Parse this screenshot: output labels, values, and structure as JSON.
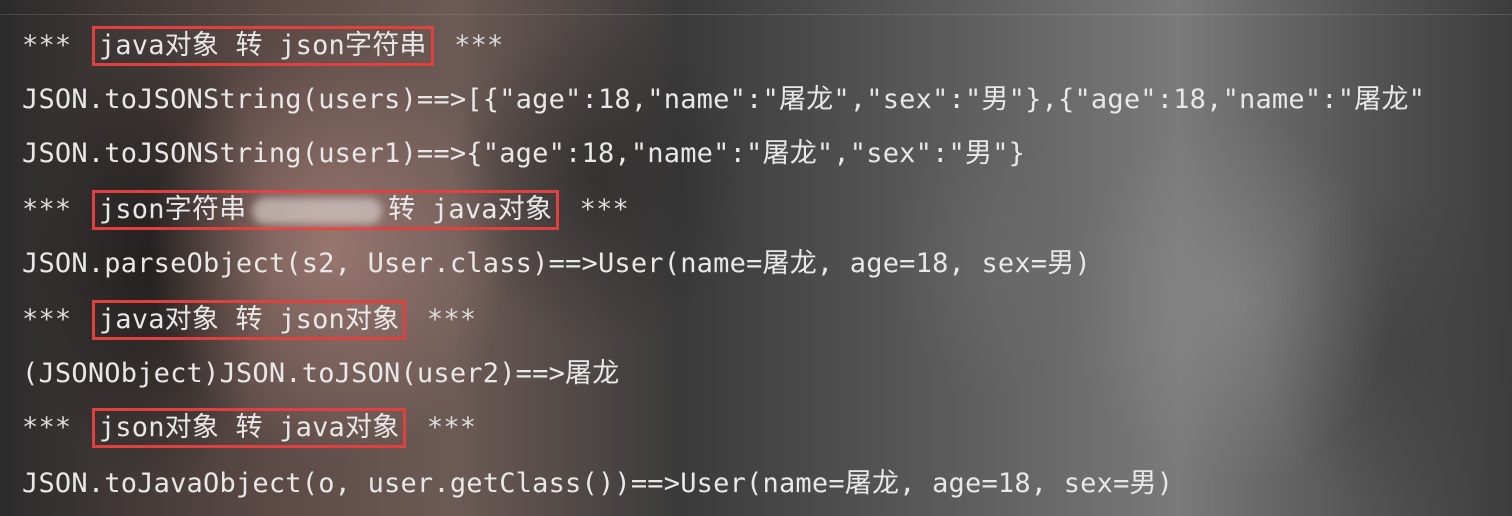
{
  "console": {
    "lines": [
      {
        "type": "section",
        "stars_left": "***",
        "label": "java对象 转 json字符串",
        "stars_right": "***"
      },
      {
        "type": "output",
        "text": "JSON.toJSONString(users)==>[{\"age\":18,\"name\":\"屠龙\",\"sex\":\"男\"},{\"age\":18,\"name\":\"屠龙\""
      },
      {
        "type": "output",
        "text": "JSON.toJSONString(user1)==>{\"age\":18,\"name\":\"屠龙\",\"sex\":\"男\"}"
      },
      {
        "type": "section",
        "stars_left": "***",
        "label_a": "json字符串",
        "label_b": "转 java对象",
        "stars_right": "***"
      },
      {
        "type": "output",
        "text": "JSON.parseObject(s2, User.class)==>User(name=屠龙, age=18, sex=男)"
      },
      {
        "type": "section",
        "stars_left": "***",
        "label": "java对象 转 json对象",
        "stars_right": "***"
      },
      {
        "type": "output",
        "text": "(JSONObject)JSON.toJSON(user2)==>屠龙"
      },
      {
        "type": "section",
        "stars_left": "***",
        "label": "json对象 转 java对象",
        "stars_right": "***"
      },
      {
        "type": "output",
        "text": "JSON.toJavaObject(o, user.getClass())==>User(name=屠龙, age=18, sex=男)"
      }
    ]
  },
  "colors": {
    "text": "#e8e8e8",
    "highlight_border": "#e04040"
  }
}
